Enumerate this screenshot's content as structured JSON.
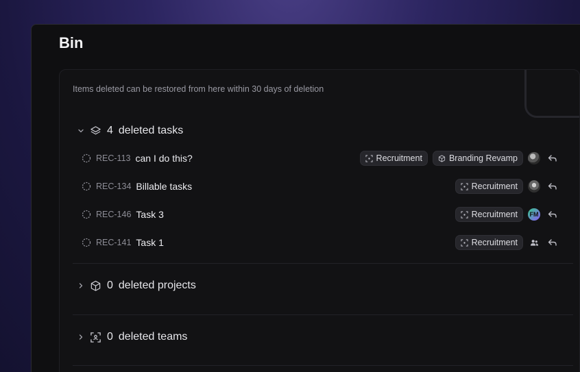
{
  "page": {
    "title": "Bin",
    "description": "Items deleted can be restored from here within 30 days of deletion"
  },
  "sections": {
    "tasks": {
      "count": "4",
      "label": "deleted tasks"
    },
    "projects": {
      "count": "0",
      "label": "deleted projects"
    },
    "teams": {
      "count": "0",
      "label": "deleted teams"
    }
  },
  "tasks": [
    {
      "id": "REC-113",
      "title": "can I do this?",
      "team": "Recruitment",
      "project": "Branding Revamp",
      "assignee": "avatar-photo"
    },
    {
      "id": "REC-134",
      "title": "Billable tasks",
      "team": "Recruitment",
      "assignee": "avatar-photo"
    },
    {
      "id": "REC-146",
      "title": "Task 3",
      "team": "Recruitment",
      "assignee": "FM"
    },
    {
      "id": "REC-141",
      "title": "Task 1",
      "team": "Recruitment",
      "assignee": "group-icon"
    }
  ],
  "colors": {
    "background": "#0f0f11",
    "panel": "#121214",
    "chip": "#26262b",
    "text_muted": "#9a9aa3",
    "avatar_fm_start": "#36c98c",
    "avatar_fm_end": "#8b5cf6"
  },
  "icons": {
    "chevron_expanded": "chevron-down-icon",
    "chevron_collapsed": "chevron-right-icon",
    "tasks": "layers-icon",
    "projects": "cube-icon",
    "teams": "team-frame-icon",
    "status": "dashed-circle-icon",
    "restore": "undo-arrow-icon"
  }
}
